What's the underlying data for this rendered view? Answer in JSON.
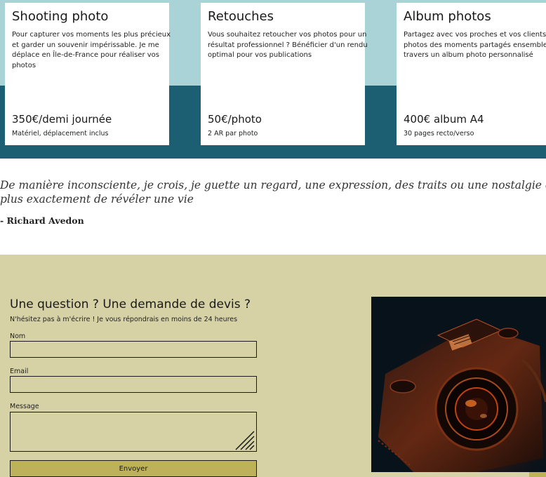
{
  "services": [
    {
      "title": "Shooting photo",
      "description_lines": [
        "Pour capturer vos moments les plus précieux",
        "et garder un souvenir impérissable. Je me",
        "déplace en Île-de-France pour réaliser vos",
        "photos"
      ],
      "price": "350€/demi journée",
      "note": "Matériel, déplacement inclus"
    },
    {
      "title": "Retouches",
      "description_lines": [
        "Vous souhaitez retoucher vos photos pour un",
        "résultat professionnel ? Bénéficier d'un rendu",
        "optimal pour vos publications"
      ],
      "price": "50€/photo",
      "note": "2 AR par photo"
    },
    {
      "title": "Album photos",
      "description_lines": [
        "Partagez avec vos proches et vos clients les",
        "photos des moments partagés ensemble à",
        "travers un album photo personnalisé"
      ],
      "price": "400€ album A4",
      "note": "30 pages recto/verso"
    }
  ],
  "quote": {
    "lines": [
      "De manière inconsciente, je crois, je guette un regard, une expression, des traits ou une nostalgie capable de résumer ou",
      "plus exactement de révéler une vie"
    ],
    "author": "- Richard Avedon"
  },
  "contact": {
    "title": "Une question ? Une demande de devis ?",
    "subtitle": "N'hésitez pas à m'écrire ! Je vous répondrais en moins de 24 heures",
    "fields": {
      "name_label": "Nom",
      "name_value": "",
      "email_label": "Email",
      "email_value": "",
      "message_label": "Message",
      "message_value": ""
    },
    "submit_label": "Envoyer",
    "photo_icon": "camera-photo"
  },
  "colors": {
    "band_light": "#a9d3d6",
    "band_dark": "#1c5e72",
    "contact_bg": "#d6d2a5",
    "button_bg": "#bdb15a"
  }
}
